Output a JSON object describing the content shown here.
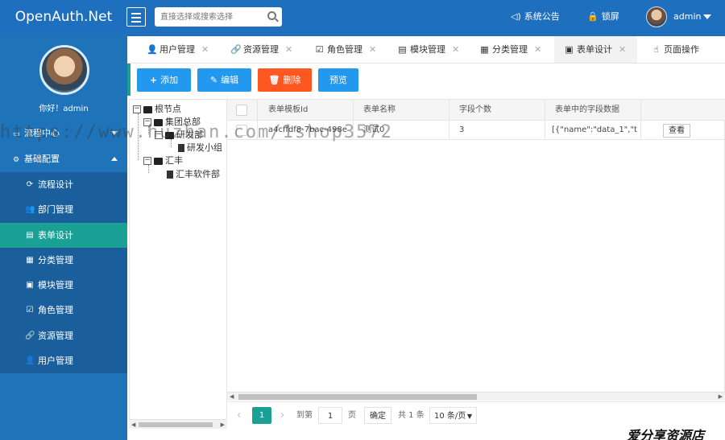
{
  "header": {
    "logo": "OpenAuth.Net",
    "search_placeholder": "直接选择或搜索选择",
    "notice_label": "系统公告",
    "lock_label": "锁屏",
    "user_name": "admin"
  },
  "sidebar": {
    "greeting": "你好！admin",
    "groups": [
      {
        "label": "流程中心",
        "icon": "square-icon",
        "expanded": false
      },
      {
        "label": "基础配置",
        "icon": "gear-icon",
        "expanded": true
      }
    ],
    "items": [
      {
        "label": "流程设计",
        "icon": "cycle-icon"
      },
      {
        "label": "部门管理",
        "icon": "users-icon"
      },
      {
        "label": "表单设计",
        "icon": "form-icon",
        "active": true
      },
      {
        "label": "分类管理",
        "icon": "calendar-icon"
      },
      {
        "label": "模块管理",
        "icon": "cube-icon"
      },
      {
        "label": "角色管理",
        "icon": "check-square-icon"
      },
      {
        "label": "资源管理",
        "icon": "link-icon"
      },
      {
        "label": "用户管理",
        "icon": "user-icon"
      }
    ]
  },
  "tabs": [
    {
      "label": "用户管理",
      "icon": "👤"
    },
    {
      "label": "资源管理",
      "icon": "🔗"
    },
    {
      "label": "角色管理",
      "icon": "☑"
    },
    {
      "label": "模块管理",
      "icon": "▤"
    },
    {
      "label": "分类管理",
      "icon": "▦"
    },
    {
      "label": "表单设计",
      "icon": "▣",
      "active": true
    },
    {
      "label": "页面操作",
      "icon": "☝"
    }
  ],
  "toolbar": {
    "add": "添加",
    "edit": "编辑",
    "delete": "删除",
    "preview": "预览",
    "colors": {
      "add": "#2299ee",
      "edit": "#2299ee",
      "delete": "#ff5722",
      "preview": "#2299ee"
    }
  },
  "tree": {
    "root": "根节点",
    "n1": "集团总部",
    "n2": "研发部",
    "n3": "研发小组",
    "n4": "汇丰",
    "n5": "汇丰软件部"
  },
  "grid": {
    "columns": [
      "表单模板Id",
      "表单名称",
      "字段个数",
      "表单中的字段数据"
    ],
    "rows": [
      {
        "id": "a4cffdf8-7bac-498e",
        "name": "测试0",
        "count": "3",
        "data": "[{\"name\":\"data_1\",\"t",
        "action": "查看"
      }
    ]
  },
  "pager": {
    "current": "1",
    "goto_label": "到第",
    "page_input": "1",
    "page_unit": "页",
    "confirm": "确定",
    "total": "共 1 条",
    "page_size": "10 条/页"
  },
  "watermarks": {
    "url": "https://www.huzhan.com/1shop3572",
    "shop": "爱分享资源店"
  }
}
